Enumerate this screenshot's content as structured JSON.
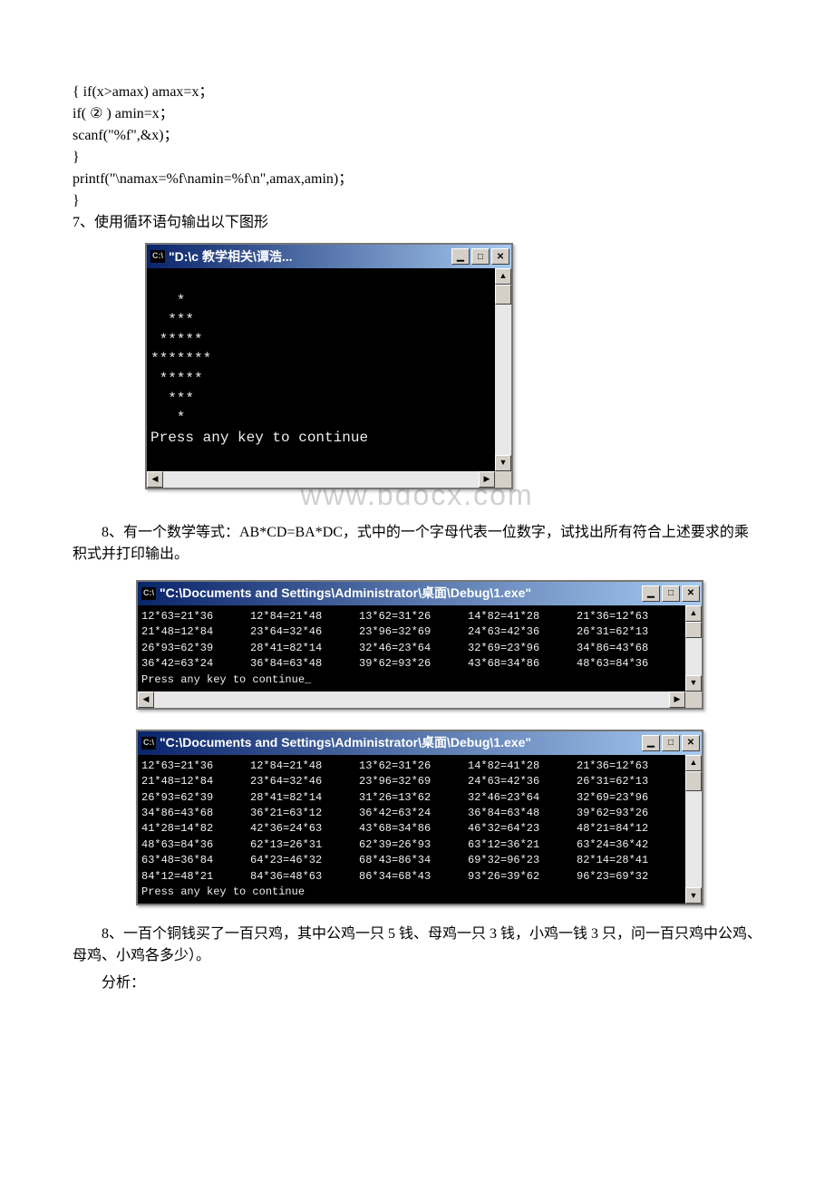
{
  "code": {
    "l1": "{ if(x>amax) amax=x；",
    "l2": "if( ② ) amin=x；",
    "l3": "scanf(\"%f\",&x)；",
    "l4": "}",
    "l5": "printf(\"\\namax=%f\\namin=%f\\n\",amax,amin)；",
    "l6": "}"
  },
  "q7": "7、使用循环语句输出以下图形",
  "console1": {
    "title": "\"D:\\c 教学相关\\谭浩...",
    "icon": "C:\\",
    "lines": [
      "   *",
      "  ***",
      " *****",
      "*******",
      " *****",
      "  ***",
      "   *",
      "Press any key to continue"
    ]
  },
  "watermark": "www.bdocx.com",
  "q8a": "8、有一个数学等式：AB*CD=BA*DC，式中的一个字母代表一位数字，试找出所有符合上述要求的乘积式并打印输出。",
  "console2": {
    "title": "\"C:\\Documents and Settings\\Administrator\\桌面\\Debug\\1.exe\"",
    "icon": "C:\\",
    "rows": [
      [
        "12*63=21*36",
        "12*84=21*48",
        "13*62=31*26",
        "14*82=41*28",
        "21*36=12*63"
      ],
      [
        "21*48=12*84",
        "23*64=32*46",
        "23*96=32*69",
        "24*63=42*36",
        "26*31=62*13"
      ],
      [
        "26*93=62*39",
        "28*41=82*14",
        "32*46=23*64",
        "32*69=23*96",
        "34*86=43*68"
      ],
      [
        "36*42=63*24",
        "36*84=63*48",
        "39*62=93*26",
        "43*68=34*86",
        "48*63=84*36"
      ]
    ],
    "footer": "Press any key to continue_"
  },
  "console3": {
    "title": "\"C:\\Documents and Settings\\Administrator\\桌面\\Debug\\1.exe\"",
    "icon": "C:\\",
    "rows": [
      [
        "12*63=21*36",
        "12*84=21*48",
        "13*62=31*26",
        "14*82=41*28",
        "21*36=12*63"
      ],
      [
        "21*48=12*84",
        "23*64=32*46",
        "23*96=32*69",
        "24*63=42*36",
        "26*31=62*13"
      ],
      [
        "26*93=62*39",
        "28*41=82*14",
        "31*26=13*62",
        "32*46=23*64",
        "32*69=23*96"
      ],
      [
        "34*86=43*68",
        "36*21=63*12",
        "36*42=63*24",
        "36*84=63*48",
        "39*62=93*26"
      ],
      [
        "41*28=14*82",
        "42*36=24*63",
        "43*68=34*86",
        "46*32=64*23",
        "48*21=84*12"
      ],
      [
        "48*63=84*36",
        "62*13=26*31",
        "62*39=26*93",
        "63*12=36*21",
        "63*24=36*42"
      ],
      [
        "63*48=36*84",
        "64*23=46*32",
        "68*43=86*34",
        "69*32=96*23",
        "82*14=28*41"
      ],
      [
        "84*12=48*21",
        "84*36=48*63",
        "86*34=68*43",
        "93*26=39*62",
        "96*23=69*32"
      ]
    ],
    "footer": "Press any key to continue"
  },
  "q8b": "8、一百个铜钱买了一百只鸡，其中公鸡一只 5 钱、母鸡一只 3 钱，小鸡一钱 3 只，问一百只鸡中公鸡、母鸡、小鸡各多少）。",
  "analysis": "分析："
}
